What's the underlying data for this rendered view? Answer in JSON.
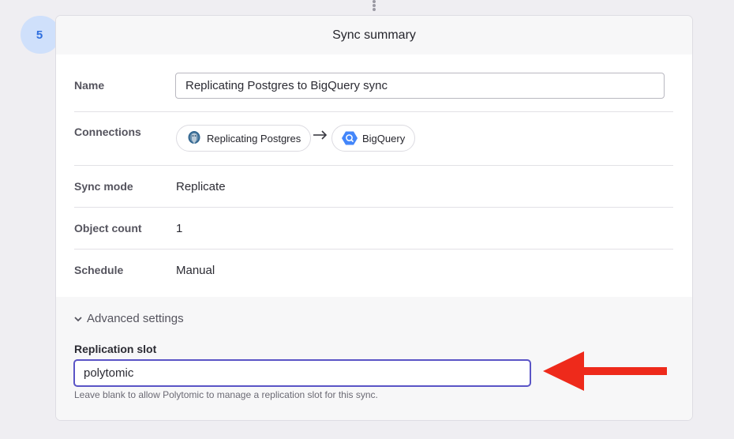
{
  "step": {
    "number": "5"
  },
  "card": {
    "title": "Sync summary"
  },
  "fields": {
    "name": {
      "label": "Name",
      "value": "Replicating Postgres to BigQuery sync"
    },
    "connections": {
      "label": "Connections",
      "source": {
        "name": "Replicating Postgres",
        "icon": "postgres-icon"
      },
      "target": {
        "name": "BigQuery",
        "icon": "bigquery-icon"
      }
    },
    "sync_mode": {
      "label": "Sync mode",
      "value": "Replicate"
    },
    "object_count": {
      "label": "Object count",
      "value": "1"
    },
    "schedule": {
      "label": "Schedule",
      "value": "Manual"
    }
  },
  "advanced": {
    "toggle_label": "Advanced settings",
    "replication_slot": {
      "label": "Replication slot",
      "value": "polytomic",
      "help": "Leave blank to allow Polytomic to manage a replication slot for this sync."
    }
  },
  "colors": {
    "accent": "#5a54c6",
    "step_badge_bg": "#cfe0fb",
    "step_badge_text": "#2f6fdf",
    "annotation_arrow": "#ee2a1b"
  }
}
